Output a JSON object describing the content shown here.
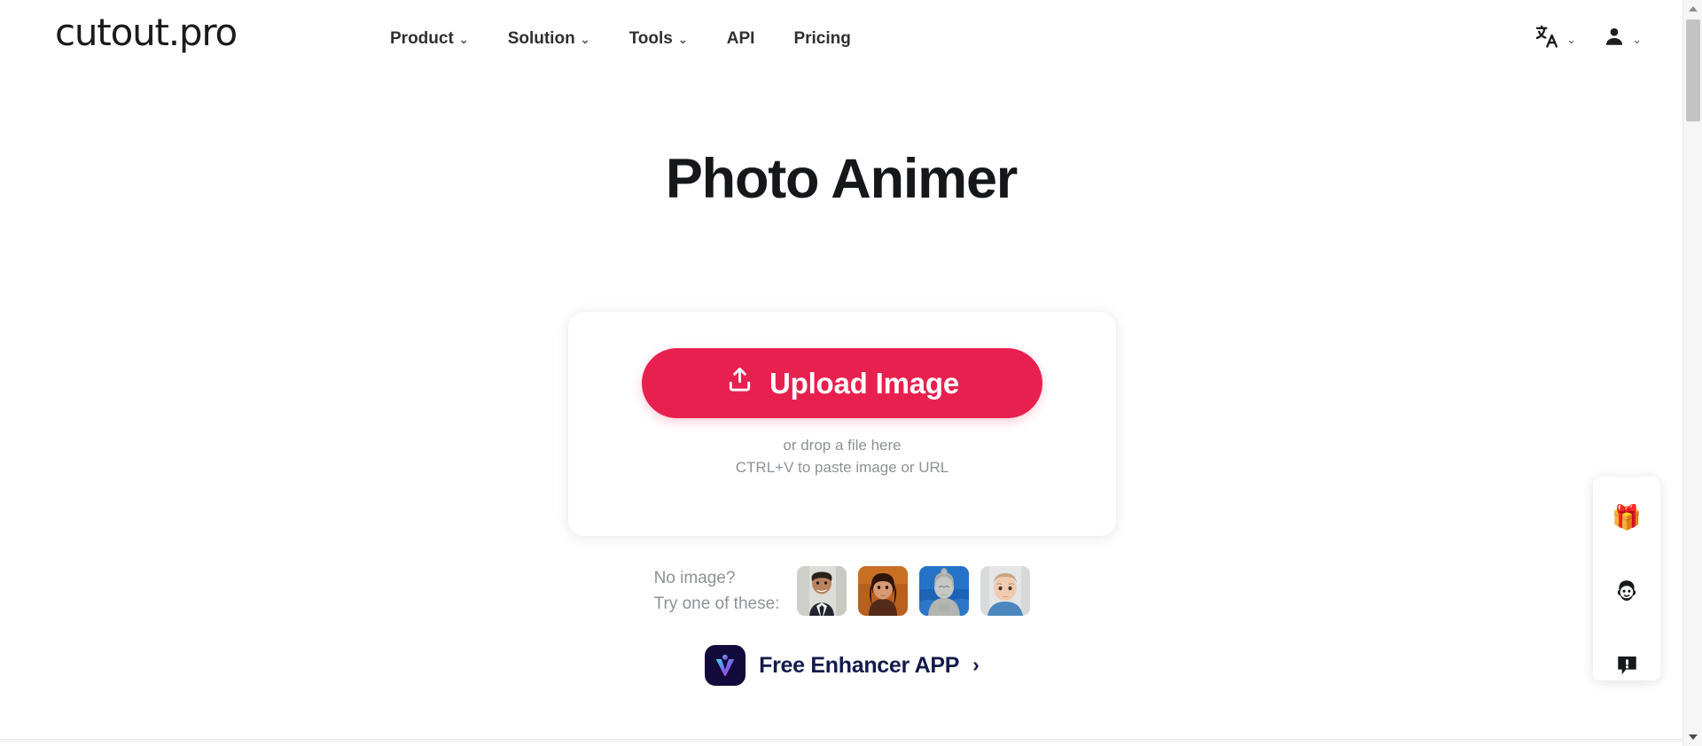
{
  "header": {
    "logo": "cutout.pro",
    "nav": [
      {
        "label": "Product",
        "has_dropdown": true,
        "chevron": "⌄"
      },
      {
        "label": "Solution",
        "has_dropdown": true,
        "chevron": "⌄"
      },
      {
        "label": "Tools",
        "has_dropdown": true,
        "chevron": "⌄"
      },
      {
        "label": "API",
        "has_dropdown": false,
        "chevron": ""
      },
      {
        "label": "Pricing",
        "has_dropdown": false,
        "chevron": ""
      }
    ],
    "controls": [
      {
        "icon": "language-translate-icon",
        "chevron": "⌄"
      },
      {
        "icon": "user-account-icon",
        "chevron": "⌄"
      }
    ]
  },
  "main": {
    "title": "Photo Animer",
    "upload": {
      "button_label": "Upload Image",
      "button_icon": "upload-icon",
      "button_color": "#E8204F",
      "hint_line1": "or drop a file here",
      "hint_line2": "CTRL+V to paste image or URL"
    },
    "samples": {
      "label_line1": "No image?",
      "label_line2": "Try one of these:",
      "thumbnails": [
        {
          "name": "sample-man-in-suit",
          "alt": "Man in suit"
        },
        {
          "name": "sample-woman-portrait",
          "alt": "Woman portrait"
        },
        {
          "name": "sample-buddha-statue",
          "alt": "Buddha statue"
        },
        {
          "name": "sample-baby-portrait",
          "alt": "Baby portrait"
        }
      ]
    },
    "enhancer": {
      "label": "Free Enhancer APP",
      "arrow": "›",
      "icon": "vance-app-icon"
    }
  },
  "side_widget": {
    "buttons": [
      {
        "name": "gift-icon",
        "glyph": "🎁"
      },
      {
        "name": "face-avatar-icon",
        "glyph": ""
      },
      {
        "name": "feedback-icon",
        "glyph": ""
      }
    ]
  },
  "scrollbar": {
    "up_arrow": "▲",
    "down_arrow": "▼"
  }
}
